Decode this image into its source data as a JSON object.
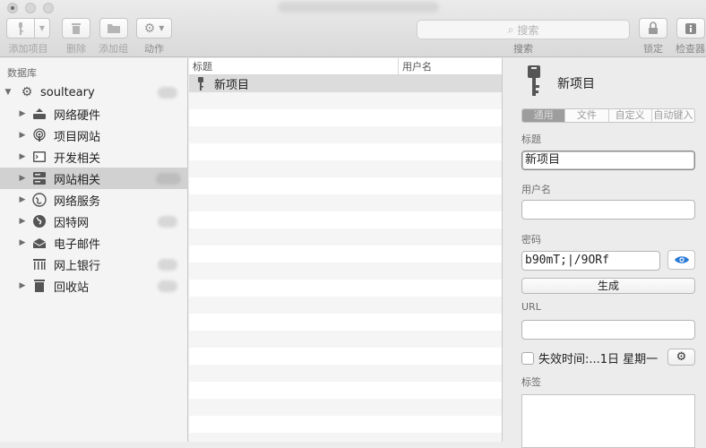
{
  "toolbar": {
    "add_entry": "添加项目",
    "delete": "删除",
    "add_group": "添加组",
    "actions": "动作",
    "search_placeholder": "搜索",
    "search_label": "搜索",
    "lock": "锁定",
    "inspector": "检查器"
  },
  "sidebar": {
    "header": "数据库",
    "database": "soulteary",
    "groups": [
      {
        "label": "网络硬件",
        "icon": "network-hardware-icon"
      },
      {
        "label": "项目网站",
        "icon": "podcast-icon"
      },
      {
        "label": "开发相关",
        "icon": "terminal-icon"
      },
      {
        "label": "网站相关",
        "icon": "server-icon"
      },
      {
        "label": "网络服务",
        "icon": "globe-icon"
      },
      {
        "label": "因特网",
        "icon": "internet-icon"
      },
      {
        "label": "电子邮件",
        "icon": "email-icon"
      },
      {
        "label": "网上银行",
        "icon": "bank-icon"
      },
      {
        "label": "回收站",
        "icon": "trash-icon"
      }
    ]
  },
  "list": {
    "col_title": "标题",
    "col_username": "用户名",
    "selected_entry_title": "新项目"
  },
  "detail": {
    "title": "新项目",
    "tabs": [
      "通用",
      "文件",
      "自定义",
      "自动键入"
    ],
    "title_label": "标题",
    "title_value": "新项目",
    "username_label": "用户名",
    "username_value": "",
    "password_label": "密码",
    "password_value": "b90mT;|/9ORf",
    "generate": "生成",
    "url_label": "URL",
    "url_value": "",
    "expire_label": "失效时间:...1日 星期一",
    "tags_label": "标签"
  }
}
